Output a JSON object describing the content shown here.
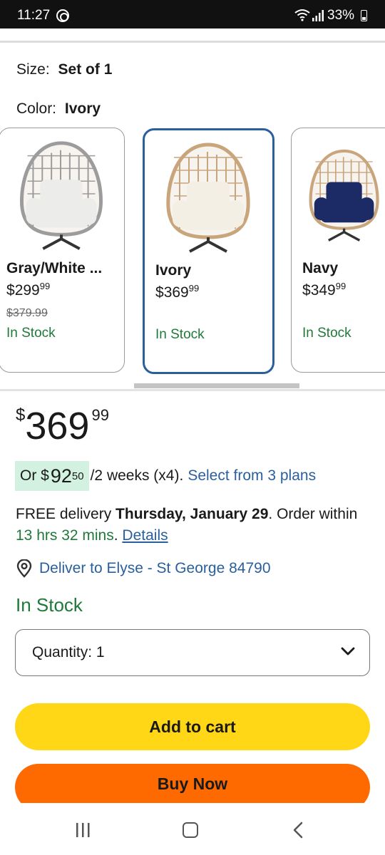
{
  "status_bar": {
    "time": "11:27",
    "battery": "33%"
  },
  "options": {
    "size_label": "Size:",
    "size_value": "Set of 1",
    "color_label": "Color:",
    "color_value": "Ivory"
  },
  "variants": [
    {
      "name": "Gray/White ...",
      "price_dollars": "299",
      "price_cents": "99",
      "was_price": "$379.99",
      "stock": "In Stock",
      "frame_color": "#9c9c9c",
      "cushion_color": "#ececea",
      "selected": false
    },
    {
      "name": "Ivory",
      "price_dollars": "369",
      "price_cents": "99",
      "was_price": "",
      "stock": "In Stock",
      "frame_color": "#c9a57c",
      "cushion_color": "#f4efe4",
      "selected": true
    },
    {
      "name": "Navy",
      "price_dollars": "349",
      "price_cents": "99",
      "was_price": "",
      "stock": "In Stock",
      "frame_color": "#c9a57c",
      "cushion_color": "#1c2a66",
      "selected": false
    }
  ],
  "currency_symbol": "$",
  "price": {
    "symbol": "$",
    "dollars": "369",
    "cents": "99"
  },
  "installment": {
    "prefix": "Or",
    "symbol": "$",
    "amount_dollars": "92",
    "amount_cents": "50",
    "suffix": "/2 weeks (x4).",
    "plans_link": "Select from 3 plans"
  },
  "delivery": {
    "prefix": "FREE delivery",
    "date": "Thursday, January 29",
    "order_text": ". Order within",
    "countdown": "13 hrs 32 mins",
    "period": ".",
    "details_link": "Details"
  },
  "deliver_to": "Deliver to Elyse - St George 84790",
  "stock_status": "In Stock",
  "quantity": {
    "label": "Quantity:",
    "value": "1"
  },
  "buttons": {
    "add_to_cart": "Add to cart",
    "buy_now": "Buy Now"
  },
  "colors": {
    "accent_blue": "#2a5f9e",
    "stock_green": "#1f7a3a",
    "add_to_cart_yellow": "#ffd716",
    "buy_now_orange": "#ff6a00",
    "installment_bg": "#d3f1e0"
  }
}
